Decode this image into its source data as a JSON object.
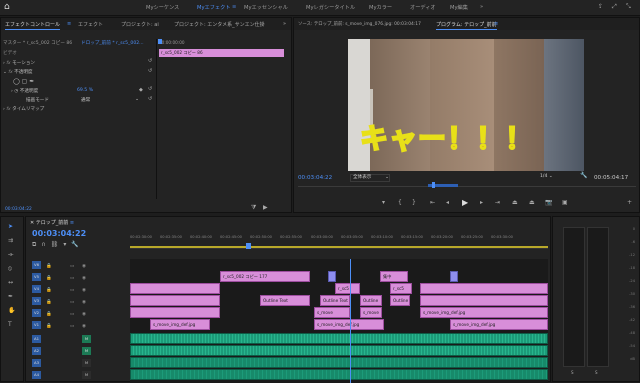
{
  "workspaces": [
    "Myシーケンス",
    "Myエフェクト",
    "Myエッセンシャル",
    "Myレガシータイトル",
    "Myカラー",
    "オーディオ",
    "My編集"
  ],
  "active_workspace_index": 1,
  "effect_controls": {
    "tabs": [
      "エフェクトコントロール",
      "エフェクト",
      "プロジェクト: ai",
      "プロジェクト: エンタメ系_サンエン仕掛"
    ],
    "master": "マスター * r_sc5_002 コピー 86",
    "sequence": "ドロップ_前前 * r_sc5_002...",
    "section_video": "ビデオ",
    "motion": "モーション",
    "opacity": "不透明度",
    "opacity_value_label": "不透明度",
    "opacity_value": "69.5 %",
    "blend_label": "描画モード",
    "blend_value": "通常",
    "time_remap": "タイムリマップ",
    "mini_timecode": "00:00:00:00",
    "mini_clip": "r_sc5_002 コピー 86",
    "timecode": "00:03:04:22"
  },
  "source_tab": "ソース: テロップ_前前: s_move_img_076.jpg: 00:03:04:17",
  "program_tab": "プログラム: テロップ_前前",
  "program": {
    "overlay_text": "キャー！！！",
    "timecode": "00:03:04:22",
    "fit": "全体表示",
    "quality": "1/4",
    "duration": "00:05:04:17"
  },
  "timeline": {
    "tab": "テロップ_前前",
    "timecode": "00:03:04:22",
    "ruler": [
      "00:02:30:00",
      "00:02:35:00",
      "00:02:40:00",
      "00:02:45:00",
      "00:02:50:00",
      "00:02:55:00",
      "00:03:00:00",
      "00:03:05:00",
      "00:03:10:00",
      "00:03:15:00",
      "00:03:20:00",
      "00:03:25:00",
      "00:03:30:00"
    ],
    "tracks_v": [
      "V6",
      "V5",
      "V4",
      "V3",
      "V2",
      "V1"
    ],
    "tracks_a": [
      "A1",
      "A2",
      "A3",
      "A4"
    ],
    "clips": {
      "v5_main": "r_sc5_002 コピー 177",
      "v5_concentrate": "集中",
      "v4_a": "r_sc5",
      "v4_b": "r_sc5",
      "v3_outline1": "Outline Text",
      "v3_outline2": "Outline Text",
      "v3_outline3": "Outline",
      "v3_outline4": "Outline",
      "v2_move1": "s_move",
      "v2_move2": "s_move",
      "v2_move3": "s_move_img_def.jpg",
      "v1_move1": "s_move_img_def.jpg",
      "v1_move2": "s_move_img_def.jpg",
      "v1_move3": "s_move_img_def.jpg"
    }
  },
  "meter": {
    "scale": [
      "0",
      "-6",
      "-12",
      "-18",
      "-24",
      "-30",
      "-36",
      "-42",
      "-48",
      "-54",
      "dB"
    ],
    "channels": [
      "S",
      "S"
    ]
  }
}
